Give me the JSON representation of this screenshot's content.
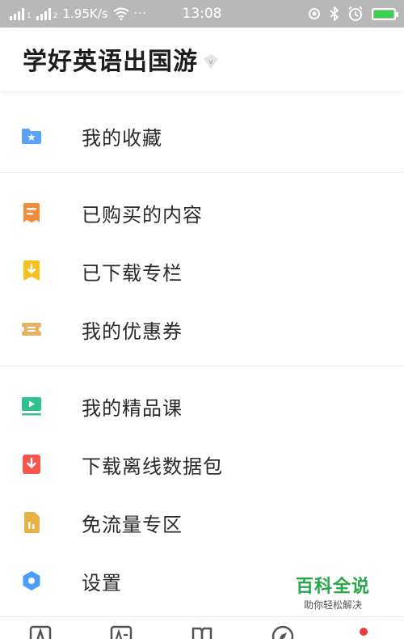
{
  "status_bar": {
    "signal_1_label": "1",
    "signal_2_label": "2",
    "speed": "1.95K/s",
    "more": "···",
    "time": "13:08",
    "battery_level": 1.0,
    "battery_color": "#3ad14b"
  },
  "header": {
    "title": "学好英语出国游",
    "badge_letter": "v"
  },
  "menu": {
    "items": [
      {
        "label": "我的收藏",
        "icon": "folder-star-icon",
        "color": "#5aa2f5"
      },
      {
        "label": "已购买的内容",
        "icon": "receipt-icon",
        "color": "#f58b3b"
      },
      {
        "label": "已下载专栏",
        "icon": "download-bookmark-icon",
        "color": "#f5c21b"
      },
      {
        "label": "我的优惠券",
        "icon": "ticket-icon",
        "color": "#e8b260"
      },
      {
        "label": "我的精品课",
        "icon": "video-play-icon",
        "color": "#2fc28c"
      },
      {
        "label": "下载离线数据包",
        "icon": "download-package-icon",
        "color": "#f5574f"
      },
      {
        "label": "免流量专区",
        "icon": "data-free-icon",
        "color": "#e8b045"
      },
      {
        "label": "设置",
        "icon": "settings-hexagon-icon",
        "color": "#4b9ef5"
      }
    ]
  },
  "bottom_tabs": [
    "tab-icon-a",
    "tab-icon-aa",
    "tab-icon-book",
    "tab-icon-compass",
    "tab-icon-me"
  ],
  "watermark": {
    "main": "百科全说",
    "sub": "助你轻松解决"
  }
}
